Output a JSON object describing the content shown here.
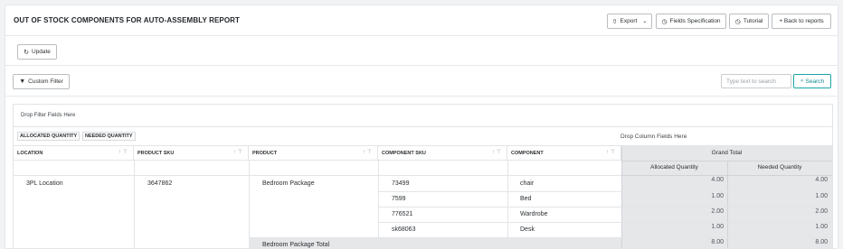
{
  "report": {
    "title": "OUT OF STOCK COMPONENTS FOR AUTO-ASSEMBLY REPORT",
    "export_label": "Export",
    "fields_label": "Fields Specification",
    "tutorial_label": "Tutorial",
    "back_label": "+ Back to reports"
  },
  "toolbar": {
    "update_label": "Update",
    "custom_filter_label": "Custom Filter",
    "search_placeholder": "Type text to search",
    "search_label": "Search"
  },
  "pivot": {
    "drop_filter_text": "Drop Filter Fields Here",
    "drop_column_text": "Drop Column Fields Here",
    "data_fields": [
      "ALLOCATED QUANTITY",
      "NEEDED QUANTITY"
    ],
    "row_headers": [
      "LOCATION",
      "PRODUCT SKU",
      "PRODUCT",
      "COMPONENT SKU",
      "COMPONENT"
    ],
    "grand_total_label": "Grand Total",
    "value_headers": [
      "Allocated Quantity",
      "Needed Quantity"
    ],
    "location": "3PL Location",
    "product_sku": "3647862",
    "product": "Bedroom Package",
    "rows": [
      {
        "component_sku": "73499",
        "component": "chair",
        "allocated": "4.00",
        "needed": "4.00"
      },
      {
        "component_sku": "7599",
        "component": "Bed",
        "allocated": "1.00",
        "needed": "1.00"
      },
      {
        "component_sku": "776521",
        "component": "Wardrobe",
        "allocated": "2.00",
        "needed": "2.00"
      },
      {
        "component_sku": "sk68063",
        "component": "Desk",
        "allocated": "1.00",
        "needed": "1.00"
      }
    ],
    "product_total": {
      "label": "Bedroom Package Total",
      "allocated": "8.00",
      "needed": "8.00"
    }
  },
  "icons": {
    "export": "upload-icon",
    "chevron": "chevron-down-icon",
    "fields": "clock-icon",
    "tutorial": "clock-icon",
    "update": "refresh-icon",
    "filter": "funnel-icon",
    "search": "search-icon"
  }
}
